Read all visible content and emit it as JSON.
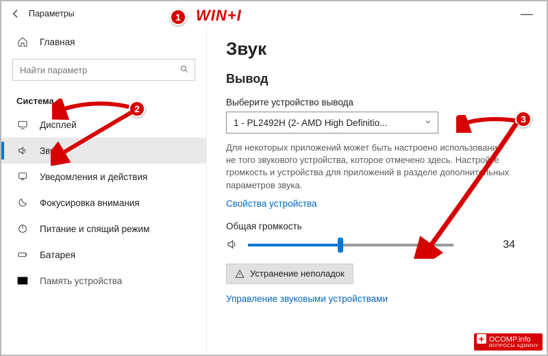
{
  "window": {
    "title": "Параметры"
  },
  "sidebar": {
    "home_label": "Главная",
    "search_placeholder": "Найти параметр",
    "section_label": "Система",
    "items": [
      {
        "label": "Дисплей"
      },
      {
        "label": "Звук"
      },
      {
        "label": "Уведомления и действия"
      },
      {
        "label": "Фокусировка внимания"
      },
      {
        "label": "Питание и спящий режим"
      },
      {
        "label": "Батарея"
      },
      {
        "label": "Память устройства"
      }
    ]
  },
  "main": {
    "heading": "Звук",
    "output_heading": "Вывод",
    "output_device_label": "Выберите устройство вывода",
    "output_device_value": "1 - PL2492H (2- AMD High Definitio...",
    "help_text": "Для некоторых приложений может быть настроено использование не того звукового устройства, которое отмечено здесь. Настройте громкость и устройства для приложений в разделе дополнительных параметров звука.",
    "device_properties_link": "Свойства устройства",
    "master_volume_label": "Общая громкость",
    "volume_value": "34",
    "volume_percent": 45,
    "troubleshoot_label": "Устранение неполадок",
    "manage_devices_link": "Управление звуковыми устройствами"
  },
  "annotations": {
    "badge1": "1",
    "badge2": "2",
    "badge3": "3",
    "hotkey": "WIN+I",
    "watermark_main": "OCOMP.info",
    "watermark_sub": "ВОПРОСЫ АДМИНУ"
  }
}
